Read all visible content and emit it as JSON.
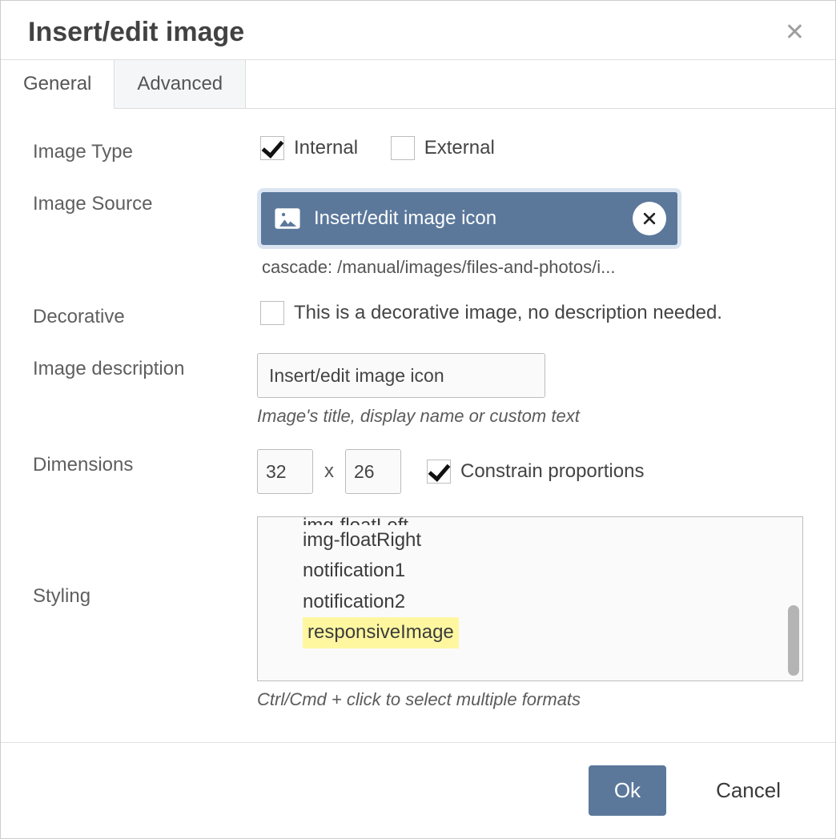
{
  "dialog": {
    "title": "Insert/edit image"
  },
  "tabs": {
    "general": "General",
    "advanced": "Advanced"
  },
  "labels": {
    "image_type": "Image Type",
    "image_source": "Image Source",
    "decorative": "Decorative",
    "image_description": "Image description",
    "dimensions": "Dimensions",
    "styling": "Styling"
  },
  "image_type": {
    "internal": {
      "label": "Internal",
      "checked": true
    },
    "external": {
      "label": "External",
      "checked": false
    }
  },
  "source": {
    "chip_label": "Insert/edit image icon",
    "path": "cascade: /manual/images/files-and-photos/i..."
  },
  "decorative": {
    "checked": false,
    "text": "This is a decorative image, no description needed."
  },
  "description": {
    "value": "Insert/edit image icon",
    "help": "Image's title, display name or custom text"
  },
  "dimensions": {
    "width": "32",
    "height": "26",
    "sep": "x",
    "constrain": {
      "label": "Constrain proportions",
      "checked": true
    }
  },
  "styling": {
    "options": {
      "o0": "img-floatLeft",
      "o1": "img-floatRight",
      "o2": "notification1",
      "o3": "notification2",
      "o4": "responsiveImage"
    },
    "highlighted": "responsiveImage",
    "help": "Ctrl/Cmd + click to select multiple formats"
  },
  "footer": {
    "ok": "Ok",
    "cancel": "Cancel"
  }
}
